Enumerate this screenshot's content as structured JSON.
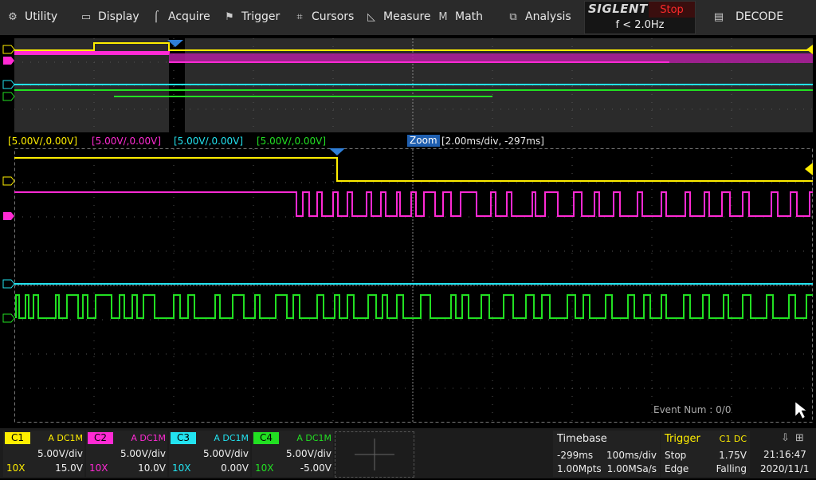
{
  "menu": {
    "utility": "Utility",
    "display": "Display",
    "acquire": "Acquire",
    "trigger": "Trigger",
    "cursors": "Cursors",
    "measure": "Measure",
    "math": "Math",
    "analysis": "Analysis",
    "decode": "DECODE"
  },
  "brand": "SIGLENT",
  "run_state": "Stop",
  "trigger_frequency": "f < 2.0Hz",
  "channel_labels": {
    "c1": "[5.00V/,0.00V]",
    "c2": "[5.00V/,0.00V]",
    "c3": "[5.00V/,0.00V]",
    "c4": "[5.00V/,0.00V]"
  },
  "zoom": {
    "badge": "Zoom",
    "info": "[2.00ms/div, -297ms]"
  },
  "event_num": "Event Num : 0/0",
  "channels": [
    {
      "tag": "C1",
      "coupling": "A DC1M",
      "scale": "5.00V/div",
      "probe": "10X",
      "offset": "15.0V",
      "color": "#ffee00"
    },
    {
      "tag": "C2",
      "coupling": "A DC1M",
      "scale": "5.00V/div",
      "probe": "10X",
      "offset": "10.0V",
      "color": "#ff2ad4"
    },
    {
      "tag": "C3",
      "coupling": "A DC1M",
      "scale": "5.00V/div",
      "probe": "10X",
      "offset": "0.00V",
      "color": "#22e3f0"
    },
    {
      "tag": "C4",
      "coupling": "A DC1M",
      "scale": "5.00V/div",
      "probe": "10X",
      "offset": "-5.00V",
      "color": "#22e022"
    }
  ],
  "timebase": {
    "title": "Timebase",
    "delay": "-299ms",
    "scale": "100ms/div",
    "memory": "1.00Mpts",
    "sample_rate": "1.00MSa/s"
  },
  "trigger": {
    "title": "Trigger",
    "source": "C1 DC",
    "mode": "Stop",
    "level": "1.75V",
    "type": "Edge",
    "slope": "Falling"
  },
  "clock": {
    "time": "21:16:47",
    "date": "2020/11/1"
  },
  "colors": {
    "c1": "#ffee00",
    "c2": "#ff2ad4",
    "c3": "#22e3f0",
    "c4": "#22e022",
    "trigger_marker": "#2f7fd8",
    "run_state": "#ff2a2a"
  }
}
